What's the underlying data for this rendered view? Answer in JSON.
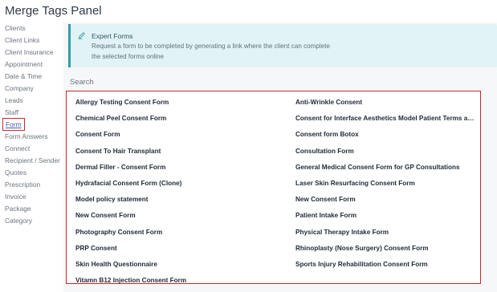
{
  "panel": {
    "title": "Merge Tags Panel"
  },
  "sidebar": {
    "items": [
      {
        "label": "Clients"
      },
      {
        "label": "Client Links"
      },
      {
        "label": "Client Insurance"
      },
      {
        "label": "Appointment"
      },
      {
        "label": "Date & Time"
      },
      {
        "label": "Company"
      },
      {
        "label": "Leads"
      },
      {
        "label": "Staff"
      },
      {
        "label": "Form"
      },
      {
        "label": "Form Answers"
      },
      {
        "label": "Connect"
      },
      {
        "label": "Recipient / Sender"
      },
      {
        "label": "Quotes"
      },
      {
        "label": "Prescription"
      },
      {
        "label": "Invoice"
      },
      {
        "label": "Package"
      },
      {
        "label": "Category"
      }
    ],
    "active": "Form"
  },
  "banner": {
    "icon": "expert-forms-icon",
    "title": "Expert Forms",
    "text": "Request a form to be completed by generating a link where the client can complete the selected forms online"
  },
  "search": {
    "placeholder": "Search",
    "value": ""
  },
  "forms": {
    "left": [
      {
        "label": "Allergy Testing Consent Form"
      },
      {
        "label": "Chemical Peel Consent Form"
      },
      {
        "label": "Consent Form"
      },
      {
        "label": "Consent To Hair Transplant"
      },
      {
        "label": "Dermal Filler - Consent Form"
      },
      {
        "label": "Hydrafacial Consent Form (Clone)"
      },
      {
        "label": "Model policy statement"
      },
      {
        "label": "New Consent Form"
      },
      {
        "label": "Photography Consent Form"
      },
      {
        "label": "PRP Consent"
      },
      {
        "label": "Skin Health Questionnaire"
      },
      {
        "label": "Vitamn B12 Injection Consent Form"
      }
    ],
    "right": [
      {
        "label": "Anti-Wrinkle Consent"
      },
      {
        "label": "Consent for Interface Aesthetics Model Patient Terms an..."
      },
      {
        "label": "Consent form Botox"
      },
      {
        "label": "Consultation Form"
      },
      {
        "label": "General Medical Consent Form for GP Consultations"
      },
      {
        "label": "Laser Skin Resurfacing Consent Form"
      },
      {
        "label": "New Consent Form"
      },
      {
        "label": "Patient Intake Form"
      },
      {
        "label": "Physical Therapy Intake Form"
      },
      {
        "label": "Rhinoplasty (Nose Surgery) Consent Form"
      },
      {
        "label": "Sports Injury Rehabilitation Consent Form"
      }
    ]
  },
  "colors": {
    "highlight_border": "#c8282e",
    "banner_bg": "#e1f3f5",
    "banner_accent": "#2f9fa8",
    "link": "#3f5fb0"
  }
}
